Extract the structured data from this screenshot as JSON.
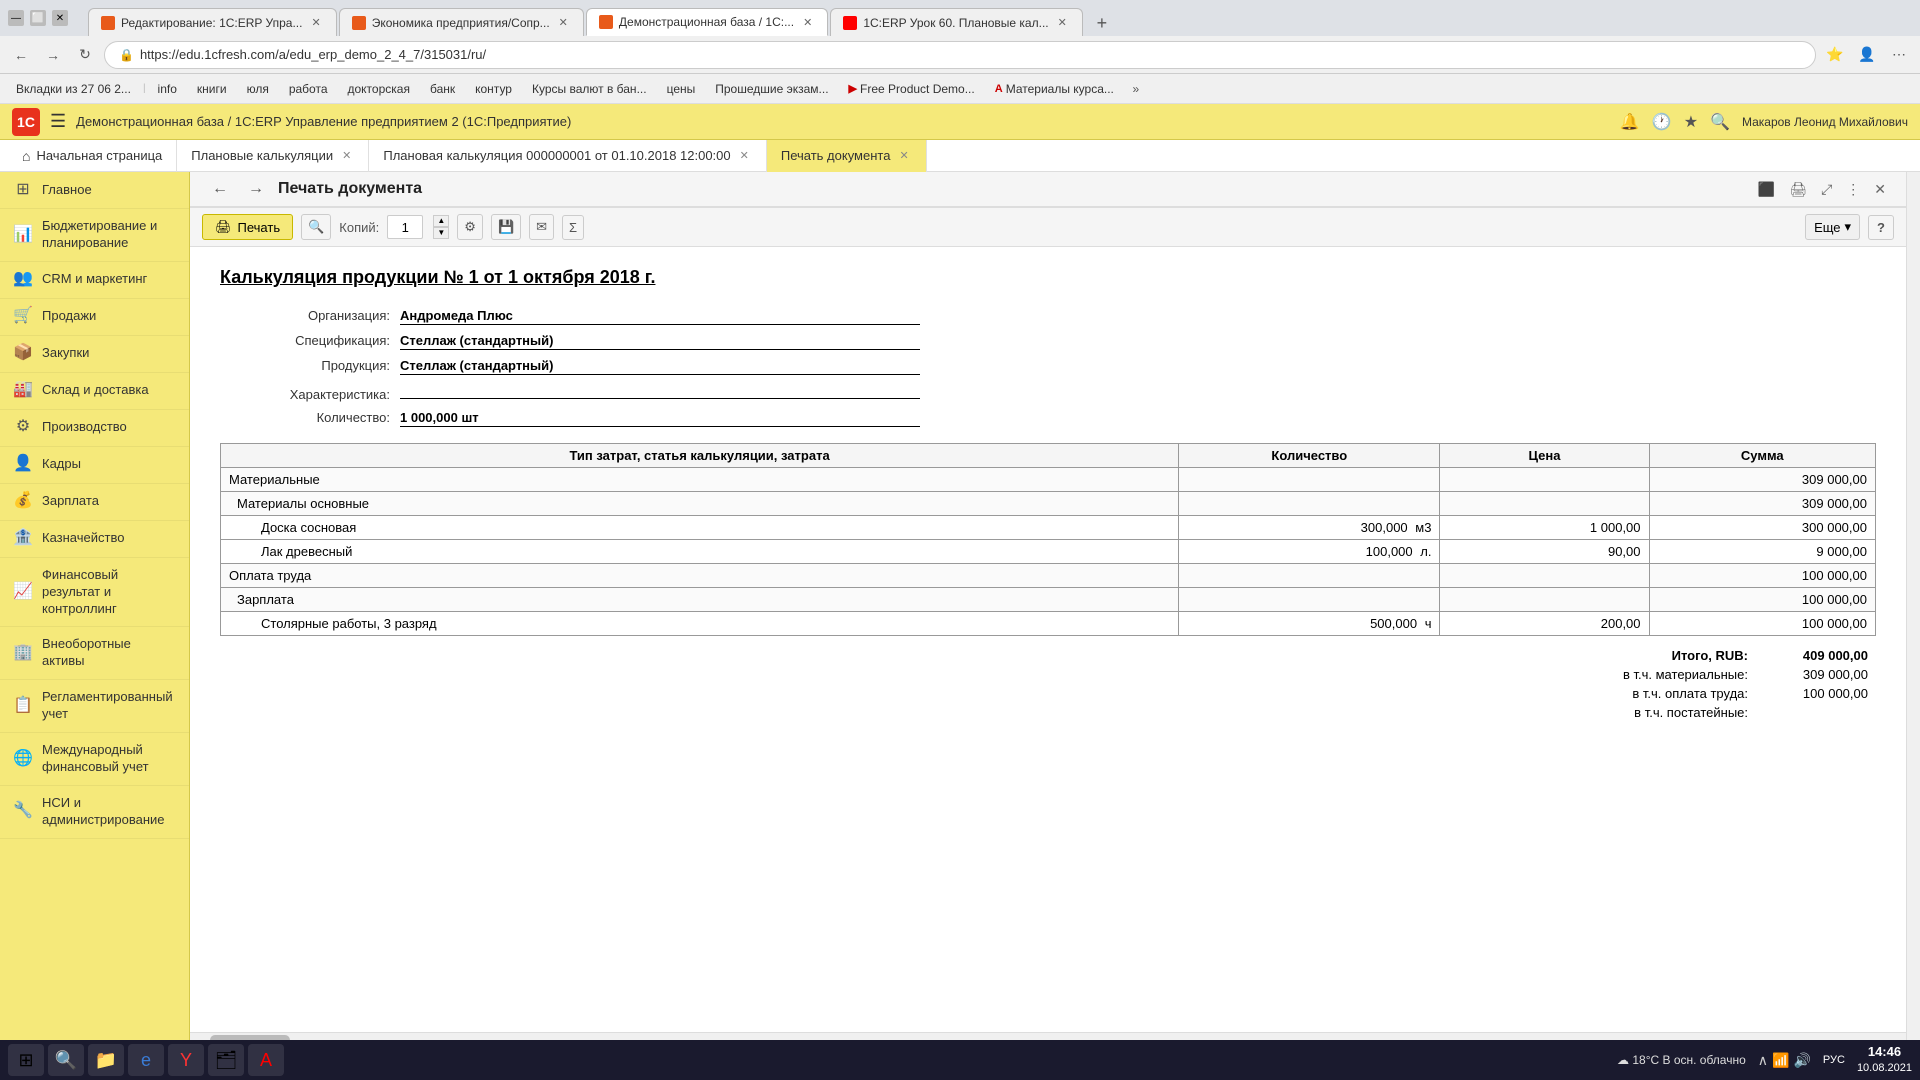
{
  "browser": {
    "tabs": [
      {
        "id": "tab1",
        "label": "Редактирование: 1С:ERP Упра...",
        "icon": "erp",
        "active": false
      },
      {
        "id": "tab2",
        "label": "Экономика предприятия/Сопр...",
        "icon": "erp",
        "active": false
      },
      {
        "id": "tab3",
        "label": "Демонстрационная база / 1С:...",
        "icon": "erp",
        "active": true
      },
      {
        "id": "tab4",
        "label": "1С:ERP Урок 60. Плановые кал...",
        "icon": "yt",
        "active": false
      }
    ],
    "address": "https://edu.1cfresh.com/a/edu_erp_demo_2_4_7/315031/ru/",
    "bookmarks": [
      {
        "label": "Вкладки из 27 06 2..."
      },
      {
        "label": "info"
      },
      {
        "label": "книги"
      },
      {
        "label": "юля"
      },
      {
        "label": "работа"
      },
      {
        "label": "докторская"
      },
      {
        "label": "банк"
      },
      {
        "label": "контур"
      },
      {
        "label": "Курсы валют в бан..."
      },
      {
        "label": "цены"
      },
      {
        "label": "Прошедшие экзам..."
      },
      {
        "label": "Free Product Demo..."
      },
      {
        "label": "Материалы курса..."
      }
    ]
  },
  "app_header": {
    "logo": "1С",
    "title": "Демонстрационная база / 1С:ERP Управление предприятием 2  (1С:Предприятие)",
    "user": "Макаров Леонид Михайлович"
  },
  "app_tabs": [
    {
      "label": "Начальная страница",
      "icon": "home",
      "active": false
    },
    {
      "label": "Плановые калькуляции",
      "closable": true,
      "active": false
    },
    {
      "label": "Плановая калькуляция 000000001 от 01.10.2018 12:00:00",
      "closable": true,
      "active": false
    },
    {
      "label": "Печать документа",
      "closable": true,
      "active": true
    }
  ],
  "sidebar": {
    "items": [
      {
        "label": "Главное",
        "icon": "⊞"
      },
      {
        "label": "Бюджетирование и планирование",
        "icon": "📊"
      },
      {
        "label": "CRM и маркетинг",
        "icon": "👥"
      },
      {
        "label": "Продажи",
        "icon": "🛒"
      },
      {
        "label": "Закупки",
        "icon": "📦"
      },
      {
        "label": "Склад и доставка",
        "icon": "🏭"
      },
      {
        "label": "Производство",
        "icon": "⚙"
      },
      {
        "label": "Кадры",
        "icon": "👤"
      },
      {
        "label": "Зарплата",
        "icon": "💰"
      },
      {
        "label": "Казначейство",
        "icon": "🏦"
      },
      {
        "label": "Финансовый результат и контроллинг",
        "icon": "📈"
      },
      {
        "label": "Внеоборотные активы",
        "icon": "🏢"
      },
      {
        "label": "Регламентированный учет",
        "icon": "📋"
      },
      {
        "label": "Международный финансовый учет",
        "icon": "🌐"
      },
      {
        "label": "НСИ и администрирование",
        "icon": "🔧"
      }
    ]
  },
  "toolbar": {
    "print_label": "Печать",
    "copies_label": "Копий:",
    "copies_value": "1",
    "mehr_label": "Еще",
    "help_label": "?"
  },
  "doc_title": "Печать документа",
  "document": {
    "heading": "Калькуляция продукции № 1 от 1 октября 2018 г.",
    "fields": [
      {
        "label": "Организация:",
        "value": "Андромеда Плюс",
        "empty": false
      },
      {
        "label": "Спецификация:",
        "value": "Стеллаж (стандартный)",
        "empty": false
      },
      {
        "label": "Продукция:",
        "value": "Стеллаж (стандартный)",
        "empty": false
      },
      {
        "label": "Характеристика:",
        "value": "",
        "empty": true
      },
      {
        "label": "Количество:",
        "value": "1 000,000 шт",
        "empty": false
      }
    ],
    "table": {
      "headers": [
        "Тип затрат, статья калькуляции, затрата",
        "Количество",
        "Цена",
        "Сумма"
      ],
      "rows": [
        {
          "type": "category",
          "name": "Материальные",
          "qty": "",
          "unit": "",
          "price": "",
          "sum": "309 000,00"
        },
        {
          "type": "subcategory",
          "name": "Материалы основные",
          "qty": "",
          "unit": "",
          "price": "",
          "sum": "309 000,00"
        },
        {
          "type": "item",
          "name": "Доска сосновая",
          "qty": "300,000",
          "unit": "м3",
          "price": "1 000,00",
          "sum": "300 000,00"
        },
        {
          "type": "item",
          "name": "Лак древесный",
          "qty": "100,000",
          "unit": "л.",
          "price": "90,00",
          "sum": "9 000,00"
        },
        {
          "type": "category",
          "name": "Оплата труда",
          "qty": "",
          "unit": "",
          "price": "",
          "sum": "100 000,00"
        },
        {
          "type": "subcategory",
          "name": "Зарплата",
          "qty": "",
          "unit": "",
          "price": "",
          "sum": "100 000,00"
        },
        {
          "type": "item",
          "name": "Столярные работы, 3 разряд",
          "qty": "500,000",
          "unit": "ч",
          "price": "200,00",
          "sum": "100 000,00"
        }
      ]
    },
    "totals": [
      {
        "label": "Итого, RUB:",
        "value": "409 000,00",
        "main": true
      },
      {
        "label": "в т.ч. материальные:",
        "value": "309 000,00",
        "main": false
      },
      {
        "label": "в т.ч. оплата труда:",
        "value": "100 000,00",
        "main": false
      },
      {
        "label": "в т.ч. постатейные:",
        "value": "",
        "main": false
      }
    ]
  },
  "taskbar": {
    "weather": "18°C  В осн. облачно",
    "time": "14:46",
    "date": "10.08.2021",
    "lang": "РУС"
  }
}
